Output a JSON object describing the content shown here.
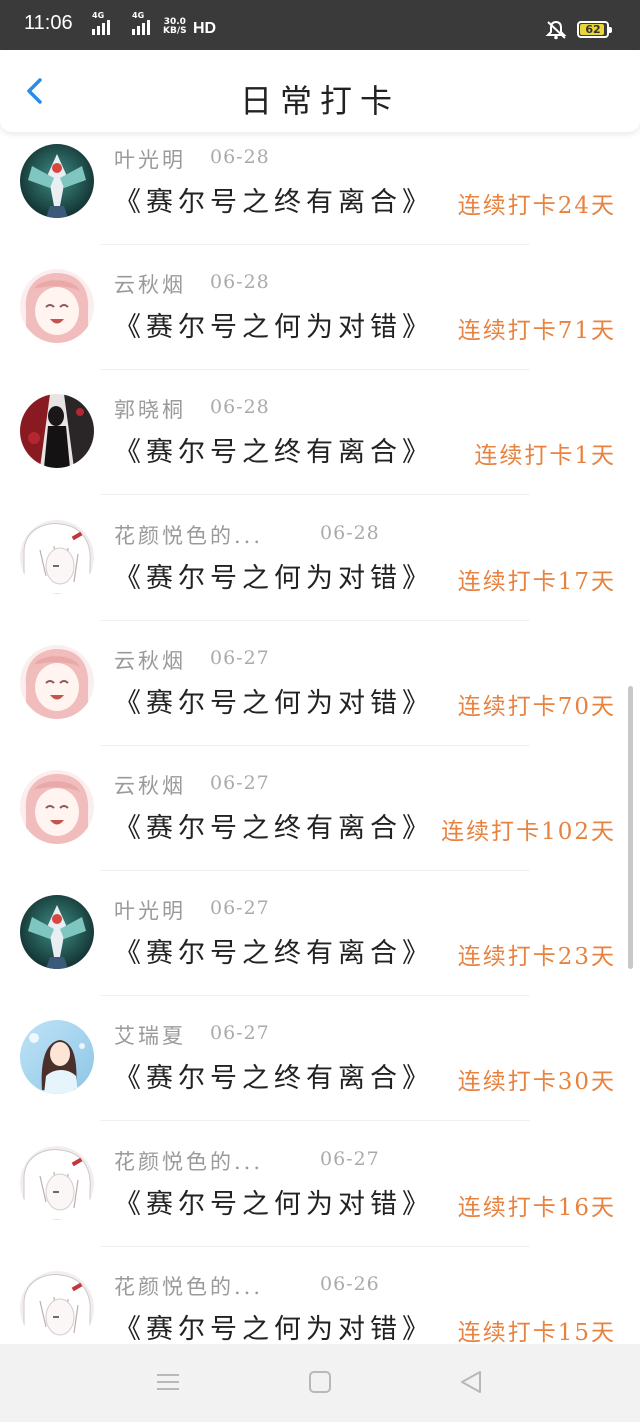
{
  "status_bar": {
    "time": "11:06",
    "network_1": "4G",
    "network_2": "4G",
    "speed_value": "30.0",
    "speed_unit": "KB/S",
    "hd": "HD",
    "battery": "62",
    "battery_color": "#e8d53a"
  },
  "header": {
    "title": "日常打卡",
    "back_icon": "chevron-left-icon",
    "accent": "#2a8be8"
  },
  "theme": {
    "streak_color": "#e8823f"
  },
  "records": [
    {
      "user": "叶光明",
      "date": "06-28",
      "book": "《赛尔号之终有离合》",
      "streak": "连续打卡24天",
      "avatar": "mecha-avatar"
    },
    {
      "user": "云秋烟",
      "date": "06-28",
      "book": "《赛尔号之何为对错》",
      "streak": "连续打卡71天",
      "avatar": "pink-hair-avatar"
    },
    {
      "user": "郭晓桐",
      "date": "06-28",
      "book": "《赛尔号之终有离合》",
      "streak": "连续打卡1天",
      "avatar": "dark-figure-avatar"
    },
    {
      "user": "花颜悦色的...",
      "date": "06-28",
      "book": "《赛尔号之何为对错》",
      "streak": "连续打卡17天",
      "avatar": "white-hair-avatar"
    },
    {
      "user": "云秋烟",
      "date": "06-27",
      "book": "《赛尔号之何为对错》",
      "streak": "连续打卡70天",
      "avatar": "pink-hair-avatar"
    },
    {
      "user": "云秋烟",
      "date": "06-27",
      "book": "《赛尔号之终有离合》",
      "streak": "连续打卡102天",
      "avatar": "pink-hair-avatar"
    },
    {
      "user": "叶光明",
      "date": "06-27",
      "book": "《赛尔号之终有离合》",
      "streak": "连续打卡23天",
      "avatar": "mecha-avatar"
    },
    {
      "user": "艾瑞夏",
      "date": "06-27",
      "book": "《赛尔号之终有离合》",
      "streak": "连续打卡30天",
      "avatar": "fantasy-girl-avatar"
    },
    {
      "user": "花颜悦色的...",
      "date": "06-27",
      "book": "《赛尔号之何为对错》",
      "streak": "连续打卡16天",
      "avatar": "white-hair-avatar"
    },
    {
      "user": "花颜悦色的...",
      "date": "06-26",
      "book": "《赛尔号之何为对错》",
      "streak": "连续打卡15天",
      "avatar": "white-hair-avatar"
    }
  ],
  "nav_bar": {
    "menu_icon": "menu-icon",
    "home_icon": "home-square-icon",
    "back_icon": "back-triangle-icon"
  }
}
